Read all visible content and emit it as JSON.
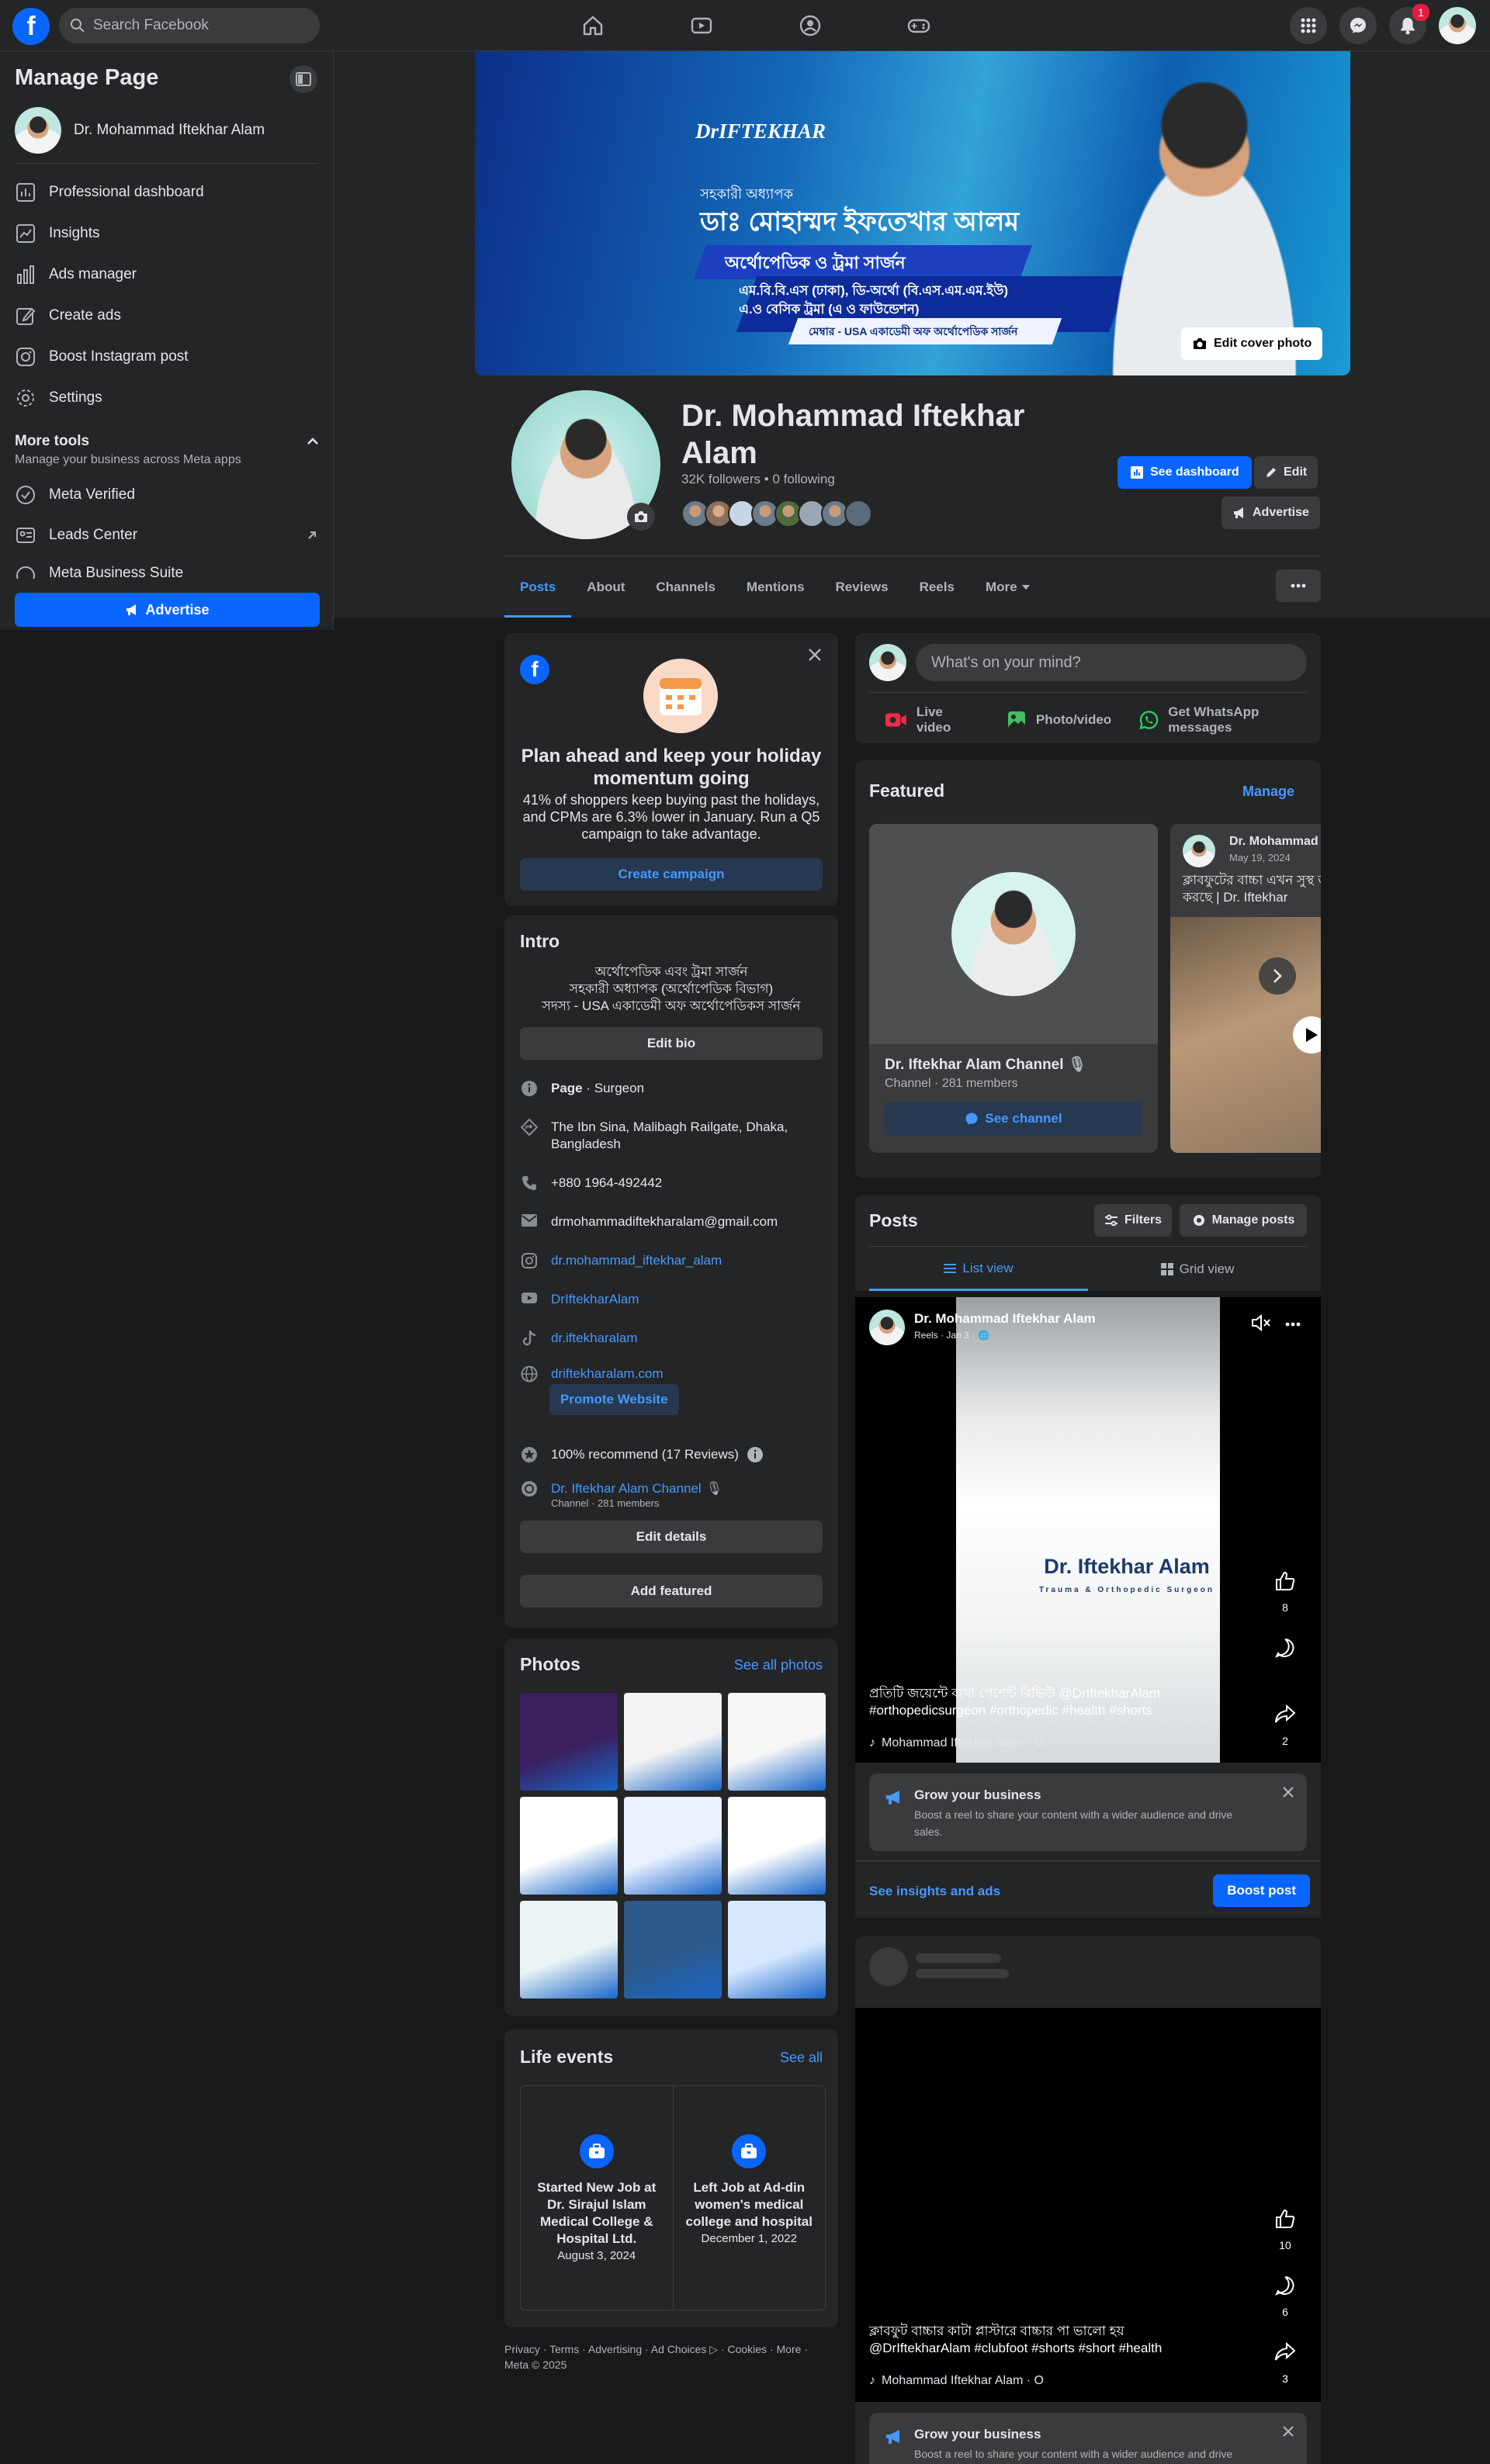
{
  "topbar": {
    "search_placeholder": "Search Facebook",
    "notif_count": "1",
    "logo": "f"
  },
  "sidebar": {
    "title": "Manage Page",
    "page_name": "Dr. Mohammad Iftekhar Alam",
    "items": [
      {
        "label": "Professional dashboard",
        "icon": "dashboard-icon"
      },
      {
        "label": "Insights",
        "icon": "insights-icon"
      },
      {
        "label": "Ads manager",
        "icon": "bar-chart-icon"
      },
      {
        "label": "Create ads",
        "icon": "edit-icon"
      },
      {
        "label": "Boost Instagram post",
        "icon": "instagram-icon"
      },
      {
        "label": "Settings",
        "icon": "gear-icon"
      }
    ],
    "more_tools_title": "More tools",
    "more_tools_sub": "Manage your business across Meta apps",
    "tools": [
      {
        "label": "Meta Verified",
        "icon": "verified-icon"
      },
      {
        "label": "Leads Center",
        "icon": "leads-icon"
      },
      {
        "label": "Meta Business Suite",
        "icon": "suite-icon"
      }
    ],
    "advertise": "Advertise"
  },
  "cover": {
    "brand": "DrIFTEKHAR",
    "line1": "সহকারী অধ্যাপক",
    "line2": "ডাঃ মোহাম্মদ ইফতেখার আলম",
    "line3": "অর্থোপেডিক ও ট্রমা সার্জন",
    "line4": "এম.বি.বি.এস (ঢাকা), ডি-অর্থো (বি.এস.এম.এম.ইউ)",
    "line5": "এ.ও বেসিক ট্রমা (এ ও ফাউন্ডেশন)",
    "line6": "মেম্বার - USA একাডেমী অফ অর্থোপেডিক সার্জন",
    "edit_cover": "Edit cover photo"
  },
  "profile": {
    "name": "Dr. Mohammad Iftekhar Alam",
    "stats": "32K followers • 0 following",
    "see_dashboard": "See dashboard",
    "edit": "Edit",
    "advertise": "Advertise"
  },
  "tabs": [
    "Posts",
    "About",
    "Channels",
    "Mentions",
    "Reviews",
    "Reels",
    "More"
  ],
  "promo": {
    "title": "Plan ahead and keep your holiday momentum going",
    "body": "41% of shoppers keep buying past the holidays, and CPMs are 6.3% lower in January. Run a Q5 campaign to take advantage.",
    "cta": "Create campaign"
  },
  "intro": {
    "title": "Intro",
    "bio1": "অর্থোপেডিক এবং ট্রমা সার্জন",
    "bio2": "সহকারী অধ্যাপক (অর্থোপেডিক বিভাগ)",
    "bio3": "সদস্য - USA একাডেমী অফ অর্থোপেডিকস সার্জন",
    "edit_bio": "Edit bio",
    "page_label": "Page",
    "page_cat": " · Surgeon",
    "address": "The Ibn Sina, Malibagh Railgate, Dhaka, Bangladesh",
    "phone": "+880 1964-492442",
    "email": "drmohammadiftekharalam@gmail.com",
    "instagram": "dr.mohammad_iftekhar_alam",
    "youtube": "DrIftekharAlam",
    "tiktok": "dr.iftekharalam",
    "website": "driftekharalam.com",
    "promote": "Promote Website",
    "recommend": "100% recommend (17 Reviews)",
    "channel": "Dr. Iftekhar Alam Channel",
    "channel_sub": "Channel · 281 members",
    "edit_details": "Edit details",
    "add_featured": "Add featured"
  },
  "photos": {
    "title": "Photos",
    "see_all": "See all photos",
    "tiles": [
      "#3b1f5e",
      "#f3f3f3",
      "#f7f7f7",
      "#ffffff",
      "#e9f0ff",
      "#ffffff",
      "#eaf4f4",
      "#2d5a8a",
      "#d6e8ff"
    ]
  },
  "life": {
    "title": "Life events",
    "see_all": "See all",
    "events": [
      {
        "text": "Started New Job at Dr. Sirajul Islam Medical College & Hospital Ltd.",
        "date": "August 3, 2024"
      },
      {
        "text": "Left Job at Ad-din women's medical college and hospital",
        "date": "December 1, 2022"
      }
    ]
  },
  "footer": {
    "text": "Privacy · Terms · Advertising · Ad Choices ▷ · Cookies · More ·",
    "copy": "Meta © 2025"
  },
  "composer": {
    "placeholder": "What's on your mind?",
    "live": "Live video",
    "photo": "Photo/video",
    "whatsapp": "Get WhatsApp messages"
  },
  "featured": {
    "title": "Featured",
    "manage": "Manage",
    "channel_name": "Dr. Iftekhar Alam Channel",
    "channel_sub": "Channel · 281 members",
    "see_channel": "See channel",
    "post_author": "Dr. Mohammad",
    "post_date": "May 19, 2024",
    "post_text": "ক্লাবফুটের বাচ্চা এখন সুস্থ জীবন যাপন করছে | Dr. Iftekhar"
  },
  "posts": {
    "title": "Posts",
    "filters": "Filters",
    "manage": "Manage posts",
    "list_view": "List view",
    "grid_view": "Grid view"
  },
  "reel1": {
    "author": "Dr. Mohammad Iftekhar Alam",
    "meta": "Reels · Jan 3 ·",
    "brand": "Dr. Iftekhar Alam",
    "brand_sub": "Trauma & Orthopedic Surgeon",
    "caption": "প্রতিটি জয়েন্টে ব্যথা পেশেন্ট রিভিউ  @DrIftekharAlam #orthopedicsurgeon #orthopedic #health #shorts",
    "sound": "Mohammad Iftekhar Alam · O",
    "likes": "8",
    "shares": "2"
  },
  "grow1": {
    "title": "Grow your business",
    "body": "Boost a reel to share your content with a wider audience and drive sales.",
    "insights": "See insights and ads",
    "boost": "Boost post"
  },
  "reel2": {
    "caption": "ক্লাবফুট বাচ্চার কাটা প্লাস্টারে বাচ্চার পা ভালো হয় @DrIftekharAlam  #clubfoot #shorts #short #health",
    "sound": "Mohammad Iftekhar Alam · O",
    "likes": "10",
    "comments": "6",
    "shares": "3"
  },
  "grow2": {
    "title": "Grow your business",
    "body": "Boost a reel to share your content with a wider audience and drive"
  }
}
